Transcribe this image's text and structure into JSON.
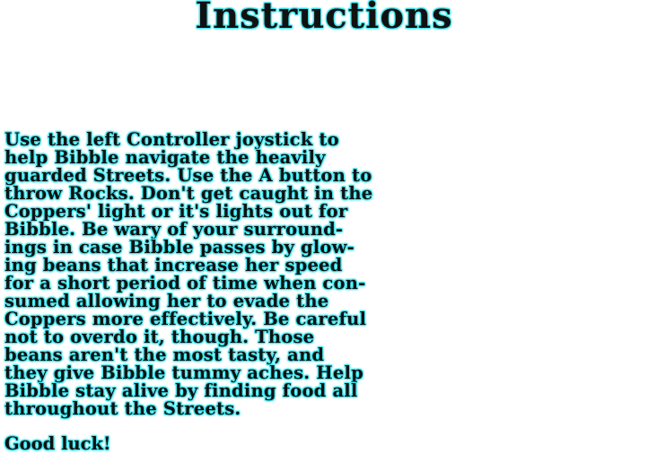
{
  "screen": {
    "title": "Instructions",
    "body_lines": [
      " Use the left Controller joystick to",
      "help Bibble navigate the heavily",
      "guarded Streets. Use the A button to",
      "throw Rocks. Don't get caught in the",
      "Coppers' light or it's lights out for",
      "Bibble. Be wary of your surround-",
      "ings in case Bibble passes by glow-",
      "ing beans that increase her speed",
      "for a short period of time when con-",
      "sumed allowing her to evade the",
      "Coppers more effectively. Be careful",
      "not to overdo it, though. Those",
      "beans aren't the most tasty, and",
      "they give Bibble tummy aches. Help",
      "Bibble stay alive by finding food all",
      "throughout the Streets."
    ],
    "closing": "Good luck!"
  },
  "colors": {
    "background": "#ffffff",
    "text": "#111111",
    "glow": "#3fe6f0"
  }
}
